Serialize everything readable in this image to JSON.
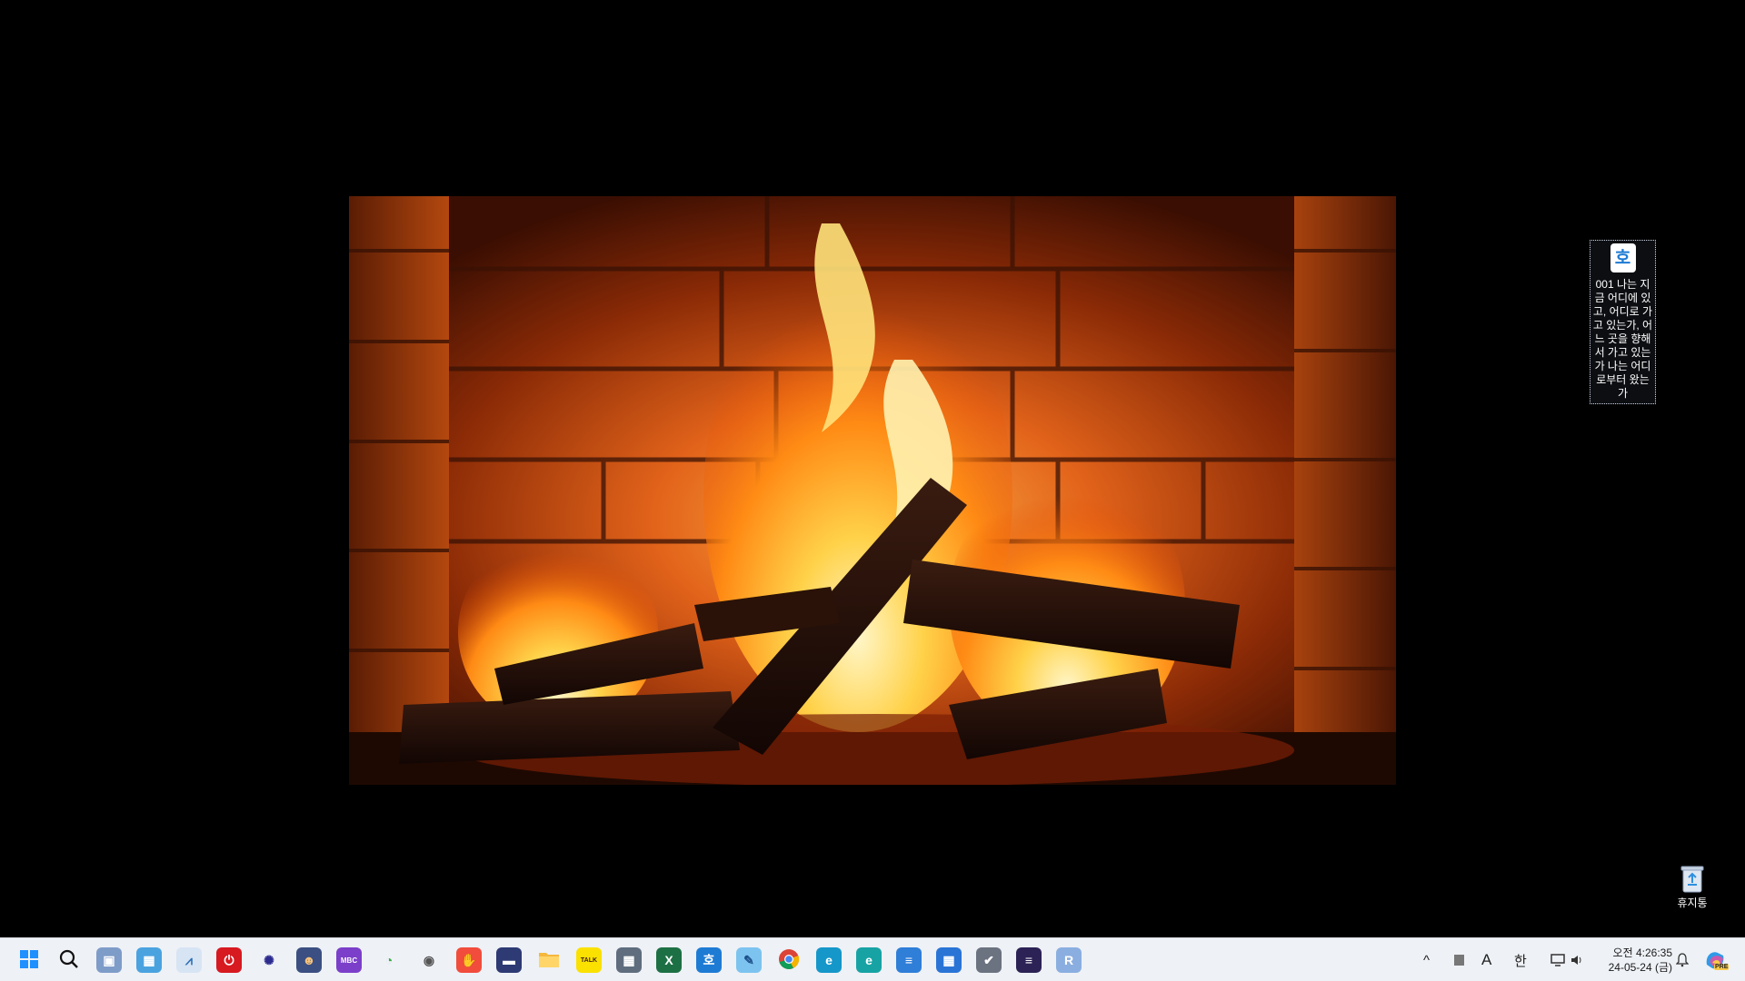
{
  "desktop": {
    "icons": [
      {
        "name": "document",
        "label": "001 나는 지금 어디에 있고, 어디로 가고 있는가, 어느 곳을 향해서 가고 있는가 나는 어디로부터 왔는가",
        "glyph": "호"
      },
      {
        "name": "recycle-bin",
        "label": "휴지통"
      }
    ]
  },
  "taskbar": {
    "apps": [
      {
        "name": "start",
        "glyph": "",
        "bg": "transparent",
        "fg": "#1a73e8"
      },
      {
        "name": "search",
        "glyph": "",
        "bg": "transparent",
        "fg": "#111"
      },
      {
        "name": "network-pc",
        "glyph": "▣",
        "bg": "#7e9cc8",
        "fg": "#fff"
      },
      {
        "name": "photo-viewer",
        "glyph": "▦",
        "bg": "#4aa3df",
        "fg": "#fff"
      },
      {
        "name": "chart-app",
        "glyph": "⩘",
        "bg": "#d7e4f4",
        "fg": "#2c6fb5"
      },
      {
        "name": "power",
        "glyph": "⏻",
        "bg": "#d71920",
        "fg": "#fff"
      },
      {
        "name": "atom",
        "glyph": "✺",
        "bg": "transparent",
        "fg": "#2a2a8f"
      },
      {
        "name": "avatar-app",
        "glyph": "☻",
        "bg": "#3b4f82",
        "fg": "#f6c27a"
      },
      {
        "name": "mbc-radio",
        "glyph": "MBC",
        "bg": "#7b3fc9",
        "fg": "#fff"
      },
      {
        "name": "timer",
        "glyph": "◔",
        "bg": "transparent",
        "fg": "#3aa84a"
      },
      {
        "name": "webcam",
        "glyph": "◉",
        "bg": "transparent",
        "fg": "#555"
      },
      {
        "name": "capture",
        "glyph": "✋",
        "bg": "#f14c3c",
        "fg": "#fff"
      },
      {
        "name": "monitor-app",
        "glyph": "▬",
        "bg": "#2d3a73",
        "fg": "#fff"
      },
      {
        "name": "file-explorer",
        "glyph": "",
        "bg": "#f5c242",
        "fg": "#fff"
      },
      {
        "name": "kakaotalk",
        "glyph": "TALK",
        "bg": "#fae100",
        "fg": "#3c1e1e"
      },
      {
        "name": "calculator",
        "glyph": "▦",
        "bg": "#5f6d7e",
        "fg": "#fff"
      },
      {
        "name": "excel",
        "glyph": "X",
        "bg": "#1d7044",
        "fg": "#fff"
      },
      {
        "name": "hwp",
        "glyph": "호",
        "bg": "#1e7bd4",
        "fg": "#fff"
      },
      {
        "name": "paint",
        "glyph": "✎",
        "bg": "#7cc3ef",
        "fg": "#1d4f8a"
      },
      {
        "name": "chrome",
        "glyph": "",
        "bg": "transparent",
        "fg": "#fff"
      },
      {
        "name": "edge",
        "glyph": "e",
        "bg": "#1597c9",
        "fg": "#fff"
      },
      {
        "name": "edge-dev",
        "glyph": "e",
        "bg": "#17a3a4",
        "fg": "#fff"
      },
      {
        "name": "notepad",
        "glyph": "≡",
        "bg": "#2f7ed8",
        "fg": "#fff"
      },
      {
        "name": "calendar",
        "glyph": "▦",
        "bg": "#2a74d6",
        "fg": "#fff"
      },
      {
        "name": "task-app",
        "glyph": "✔",
        "bg": "#6b7280",
        "fg": "#fff"
      },
      {
        "name": "eclipse",
        "glyph": "≡",
        "bg": "#2c2255",
        "fg": "#fff"
      },
      {
        "name": "r-lang",
        "glyph": "R",
        "bg": "#8aaee0",
        "fg": "#fff"
      }
    ]
  },
  "tray": {
    "chevron": "^",
    "ime_mode": "A",
    "ime_lang": "한",
    "time": "오전 4:26:35",
    "date": "24-05-24 (금)",
    "copilot_badge": "PRE"
  }
}
